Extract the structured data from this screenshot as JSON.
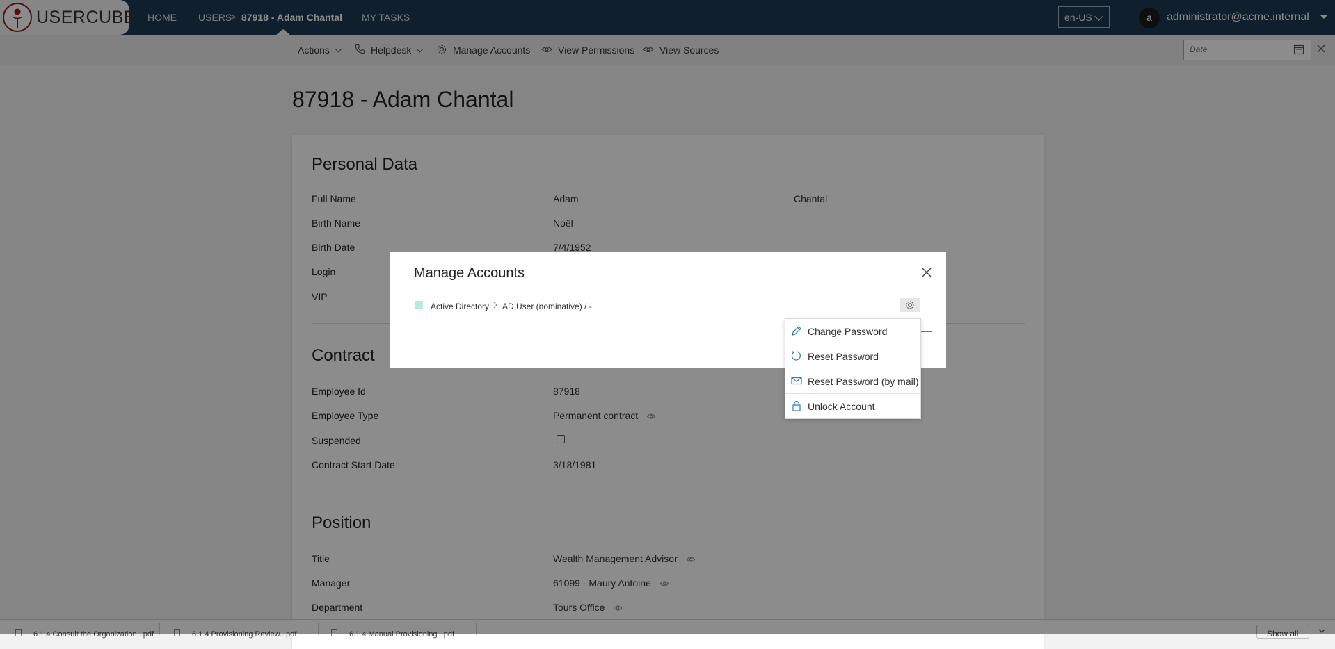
{
  "nav": {
    "logo_text": "USERCUBE",
    "home": "HOME",
    "users": "USERS",
    "breadcrumb_sep": ">",
    "current": "87918 - Adam Chantal",
    "tasks": "MY TASKS",
    "language": "en-US",
    "avatar_letter": "a",
    "user": "administrator@acme.internal"
  },
  "actions": {
    "actions": "Actions",
    "helpdesk": "Helpdesk",
    "manage_accounts": "Manage Accounts",
    "view_permissions": "View Permissions",
    "view_sources": "View Sources",
    "date_placeholder": "Date"
  },
  "page": {
    "title": "87918 - Adam Chantal",
    "personal": {
      "title": "Personal Data",
      "full_name_label": "Full Name",
      "first_name": "Adam",
      "last_name": "Chantal",
      "birth_name_label": "Birth Name",
      "birth_name": "Noël",
      "birth_date_label": "Birth Date",
      "birth_date": "7/4/1952",
      "login_label": "Login",
      "vip_label": "VIP"
    },
    "contract": {
      "title": "Contract",
      "employee_id_label": "Employee Id",
      "employee_id": "87918",
      "employee_type_label": "Employee Type",
      "employee_type": "Permanent contract",
      "suspended_label": "Suspended",
      "suspended": false,
      "start_date_label": "Contract Start Date",
      "start_date": "3/18/1981"
    },
    "position": {
      "title": "Position",
      "title_label": "Title",
      "title_value": "Wealth Management Advisor",
      "manager_label": "Manager",
      "manager": "61099 - Maury Antoine",
      "department_label": "Department",
      "department": "Tours Office"
    }
  },
  "modal": {
    "title": "Manage Accounts",
    "crumb_system": "Active Directory",
    "crumb_account": "AD User (nominative) / -",
    "menu": [
      {
        "label": "Change Password",
        "icon": "pencil-icon"
      },
      {
        "label": "Reset Password",
        "icon": "refresh-icon"
      },
      {
        "label": "Reset Password (by mail)",
        "icon": "mail-icon"
      },
      {
        "label": "Unlock Account",
        "icon": "lock-icon"
      }
    ]
  },
  "downloads": {
    "items": [
      "6.1.4 Consult the Organization...pdf",
      "6.1.4 Provisioning Review...pdf",
      "6.1.4 Manual Provisioning...pdf"
    ],
    "show_all": "Show all"
  },
  "colors": {
    "nav_bg": "#1d3a52",
    "accent_icon": "#2a7fb8",
    "ad_square": "#b5ecdf"
  }
}
